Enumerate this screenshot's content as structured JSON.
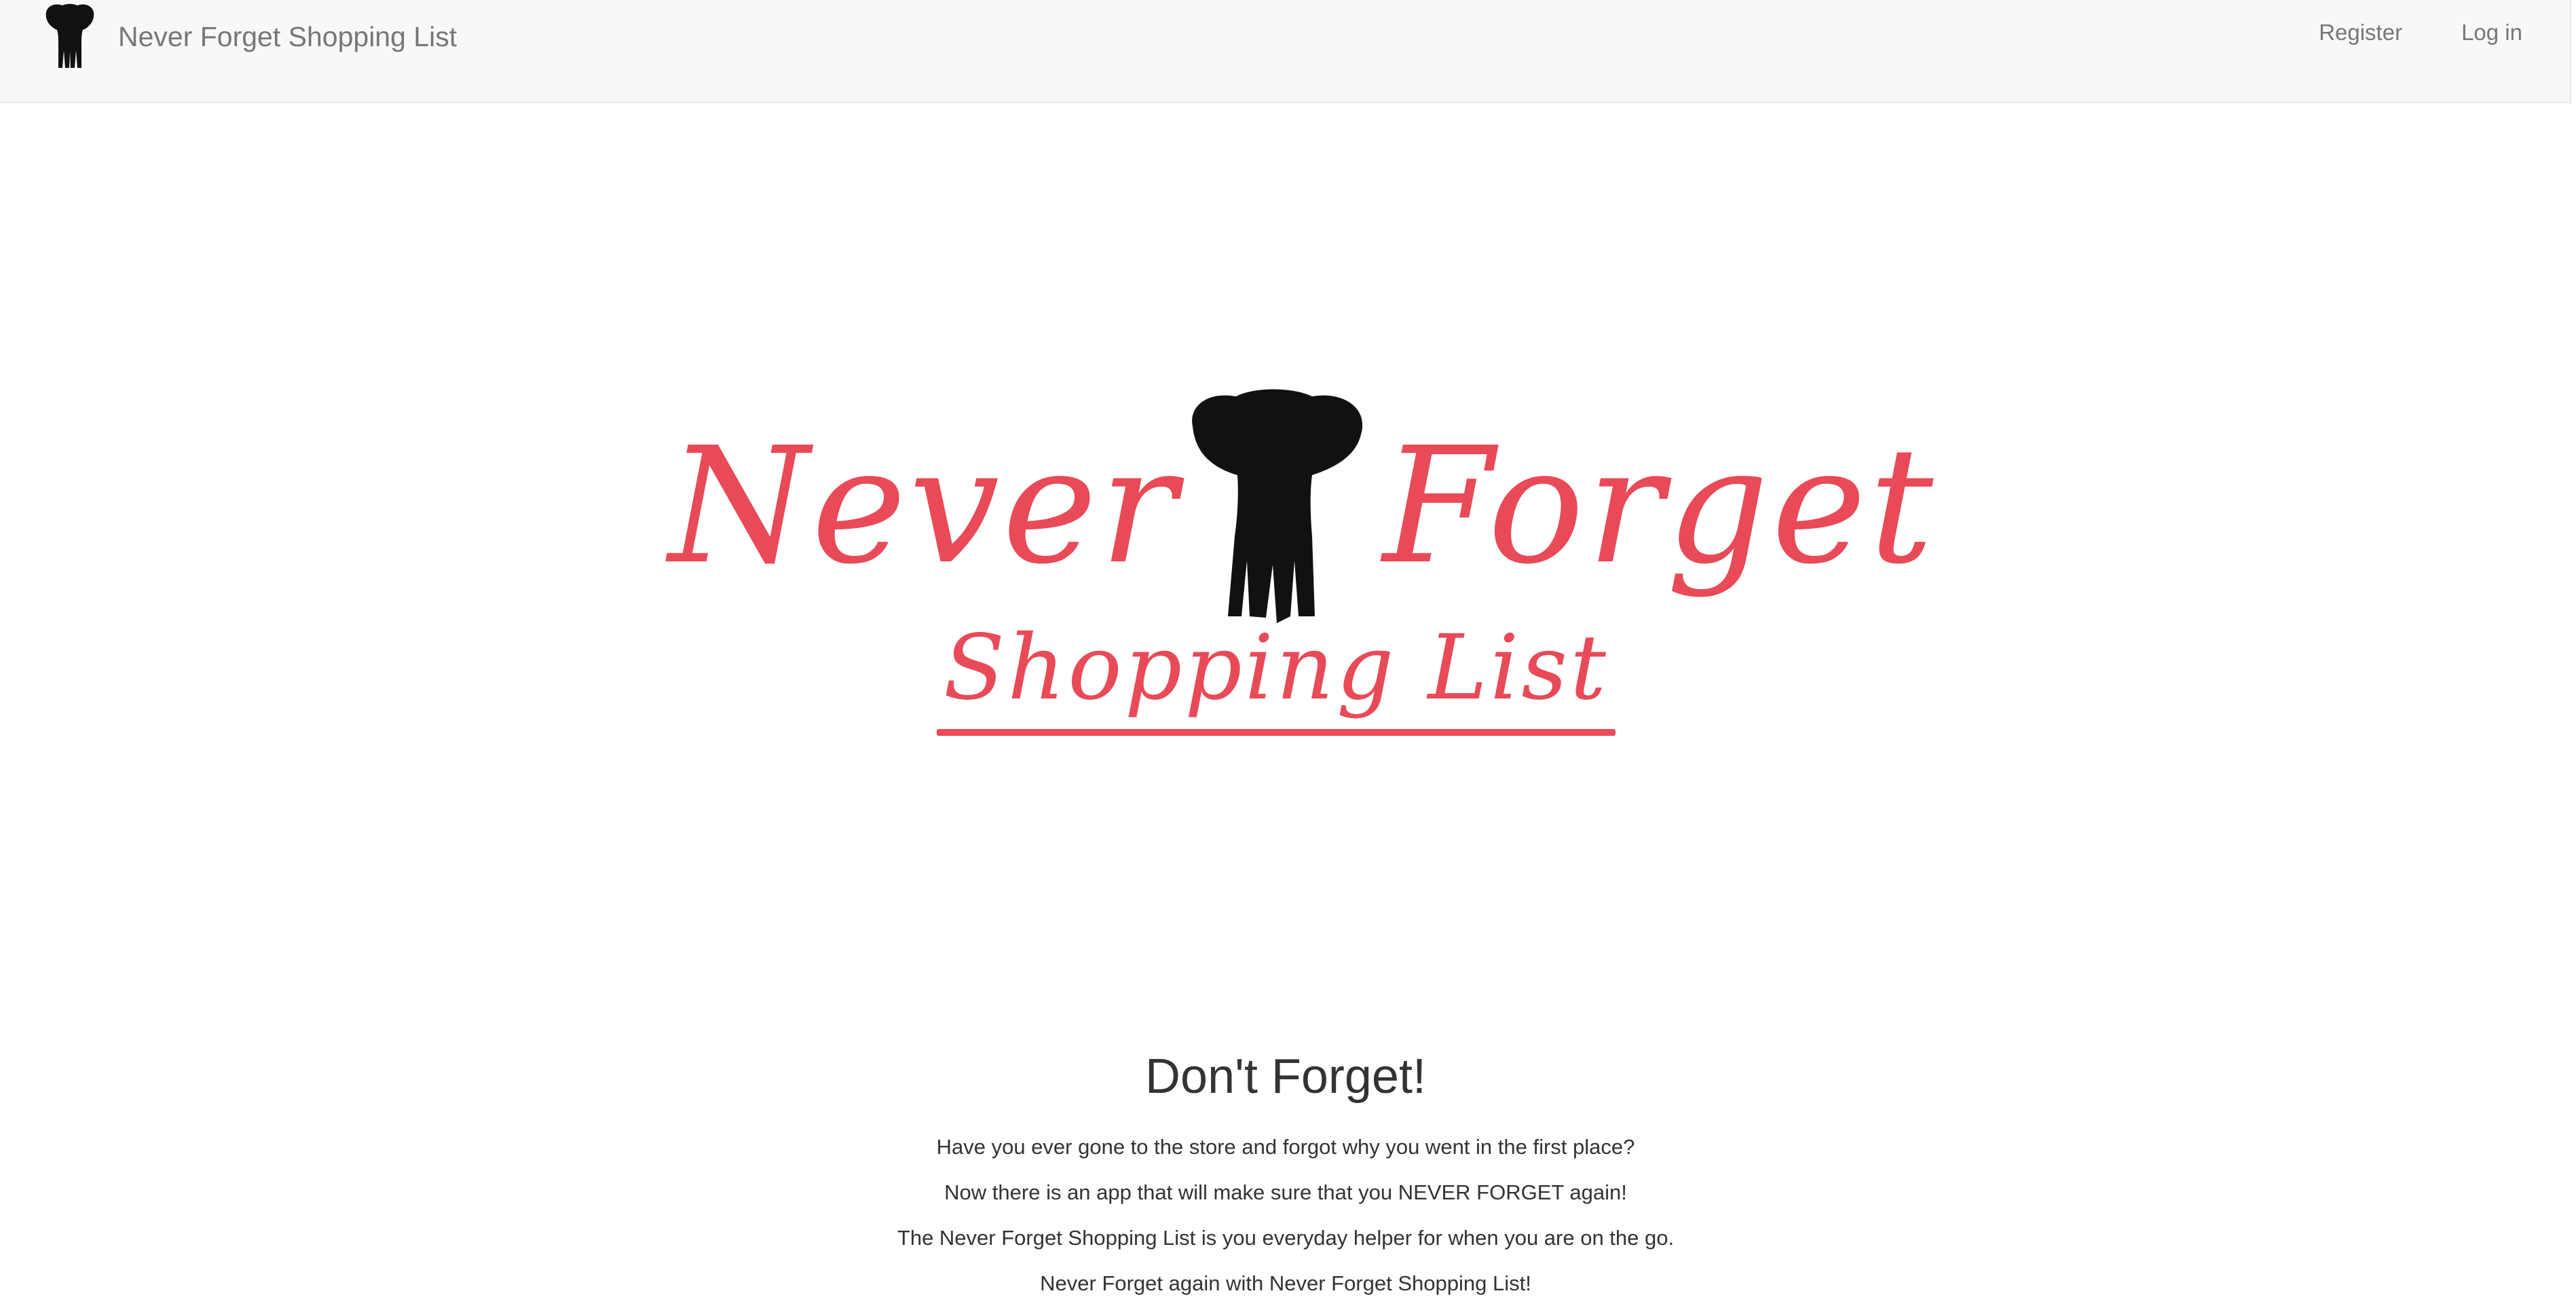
{
  "navbar": {
    "brand_text": "Never Forget Shopping List",
    "logo_icon": "elephant-icon",
    "links": {
      "register": "Register",
      "login": "Log in"
    }
  },
  "hero": {
    "logo_lettering": {
      "left_word": "Never",
      "right_word": "Forget",
      "subtitle": "Shopping List"
    },
    "accent_color": "#e84a57"
  },
  "main": {
    "heading": "Don't Forget!",
    "paragraphs": [
      "Have you ever gone to the store and forgot why you went in the first place?",
      "Now there is an app that will make sure that you NEVER FORGET again!",
      "The Never Forget Shopping List is you everyday helper for when you are on the go.",
      "Never Forget again with Never Forget Shopping List!"
    ]
  }
}
